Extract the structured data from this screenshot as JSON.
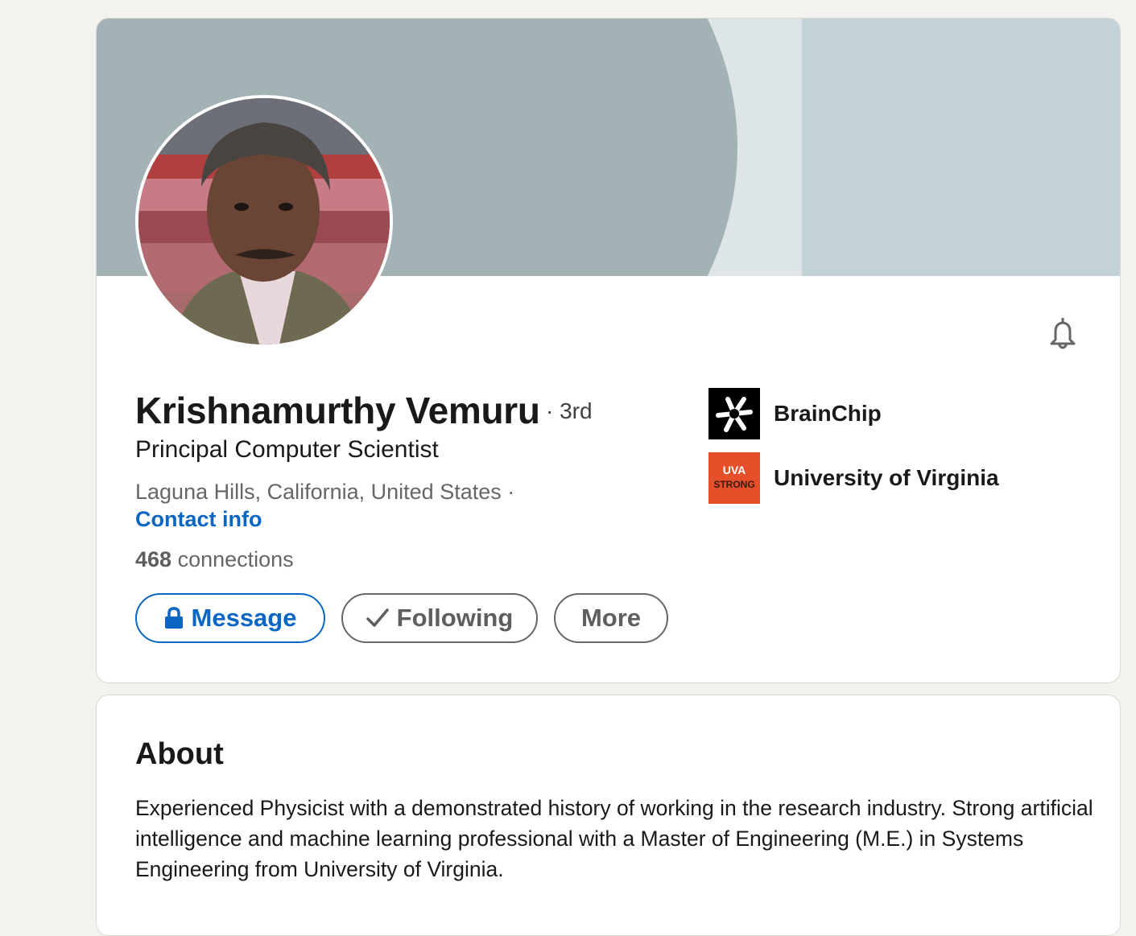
{
  "profile": {
    "name": "Krishnamurthy Vemuru",
    "degree": "· 3rd",
    "headline": "Principal Computer Scientist",
    "location": "Laguna Hills, California, United States ·",
    "contact_info": "Contact info",
    "connections_count": "468",
    "connections_label": "connections"
  },
  "actions": {
    "message": "Message",
    "following": "Following",
    "more": "More"
  },
  "icons": {
    "notify": "bell-icon",
    "message": "lock-icon",
    "following": "check-icon"
  },
  "organizations": [
    {
      "name": "BrainChip",
      "logo": "brainchip-logo"
    },
    {
      "name": "University of Virginia",
      "logo": "uva-logo",
      "logo_text_top": "UVA",
      "logo_text_bottom": "STRONG"
    }
  ],
  "about": {
    "title": "About",
    "text": "Experienced Physicist with a demonstrated history of working in the research industry. Strong artificial intelligence and machine learning professional with a Master of Engineering (M.E.) in Systems Engineering from University of Virginia."
  },
  "colors": {
    "accent": "#0a66c2",
    "page_bg": "#f3f2ef",
    "banner_light": "#c2d2d6",
    "banner_mid": "#a3b3b5",
    "uva_orange": "#e5502b"
  }
}
